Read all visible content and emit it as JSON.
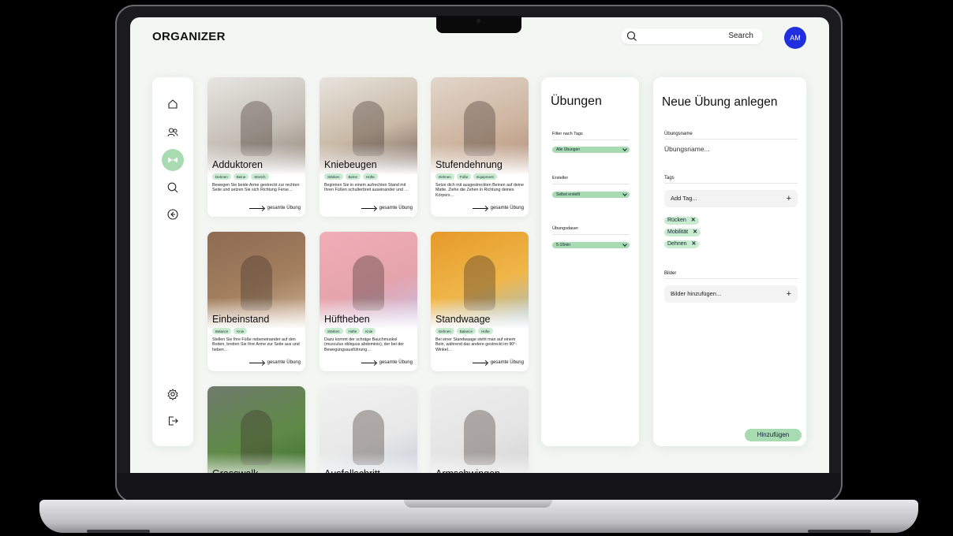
{
  "app": {
    "title": "ORGANIZER"
  },
  "search": {
    "label": "Search"
  },
  "avatar": {
    "initials": "AM"
  },
  "sidebar": {
    "items": [
      {
        "name": "home-icon"
      },
      {
        "name": "users-icon"
      },
      {
        "name": "exercise-icon",
        "active": true
      },
      {
        "name": "search-icon"
      },
      {
        "name": "back-icon"
      }
    ],
    "bottom": [
      {
        "name": "settings-icon"
      },
      {
        "name": "logout-icon"
      }
    ]
  },
  "cards": [
    {
      "title": "Adduktoren",
      "tags": [
        "Dehnen",
        "Beine",
        "Stretch"
      ],
      "desc": "Bewegen Sie beide Arme gestreckt zur rechten Seite und setzen Sie sich Richtung Ferse…",
      "link": "gesamte Übung",
      "colors": [
        "#e8e6e2",
        "#c4beb5",
        "#8b7d72"
      ]
    },
    {
      "title": "Kniebeugen",
      "tags": [
        "Stärken",
        "Beine",
        "Hüfte"
      ],
      "desc": "Beginnen Sie in einem aufrechten Stand mit Ihren Füßen schulterbreit auseinander und …",
      "link": "gesamte Übung",
      "colors": [
        "#e7e4dd",
        "#c9b9a6",
        "#6e5b52"
      ]
    },
    {
      "title": "Stufendehnung",
      "tags": [
        "Dehnen",
        "Füße",
        "Equipment"
      ],
      "desc": "Setze dich mit ausgestreckten Beinen auf deine Matte. Ziehe die Zehen in Richtung deines Körpers…",
      "link": "gesamte Übung",
      "colors": [
        "#e2d6cb",
        "#cdb5a0",
        "#b28d75"
      ]
    },
    {
      "title": "Einbeinstand",
      "tags": [
        "Balance",
        "Knie"
      ],
      "desc": "Stellen Sie Ihre Füße nebeneinander auf den Boden, breiten Sie Ihre Arme zur Seite aus und heben…",
      "link": "gesamte Übung",
      "colors": [
        "#8d6a52",
        "#a4805f",
        "#d0b79c"
      ]
    },
    {
      "title": "Hüftheben",
      "tags": [
        "Stärken",
        "Hüfte",
        "Knie"
      ],
      "desc": "Dazu kommt der schräge Bauchmuskel (musculus obliquus abdominis), der bei der Bewegungsausführung…",
      "link": "gesamte Übung",
      "colors": [
        "#f2aeb8",
        "#e5a3ac",
        "#c8c0e6"
      ]
    },
    {
      "title": "Standwaage",
      "tags": [
        "Dehnen",
        "Balance",
        "Hüfte"
      ],
      "desc": "Bei einer Standwaage steht man auf einem Bein, während das andere gestreckt im 90°-Winkel…",
      "link": "gesamte Übung",
      "colors": [
        "#e59a2a",
        "#f0b649",
        "#9fc3d8"
      ]
    },
    {
      "title": "Grasswalk",
      "tags": [],
      "desc": "",
      "link": "",
      "colors": [
        "#6f7b6d",
        "#5e8a46",
        "#3b6e2c"
      ]
    },
    {
      "title": "Ausfallschritt",
      "tags": [],
      "desc": "",
      "link": "",
      "colors": [
        "#f2f2f2",
        "#e8e8e8",
        "#bfc9d6"
      ]
    },
    {
      "title": "Armschwingen",
      "tags": [],
      "desc": "",
      "link": "",
      "colors": [
        "#eeeeee",
        "#e4e4e4",
        "#cfcfcf"
      ]
    }
  ],
  "filters": {
    "title": "Übungen",
    "groups": [
      {
        "label": "Filter nach Tags",
        "value": "Alle Übungen"
      },
      {
        "label": "Ersteller",
        "value": "Selbst erstellt"
      },
      {
        "label": "Übungsdauer",
        "value": "5-10min"
      }
    ]
  },
  "new_exercise": {
    "title": "Neue Übung anlegen",
    "name_label": "Übungsname",
    "name_placeholder": "Übungsname...",
    "tags_label": "Tags",
    "add_tag": "Add Tag...",
    "tags": [
      "Rücken",
      "Mobilität",
      "Dehnen"
    ],
    "images_label": "Bilder",
    "add_images": "Bilder hinzufügen...",
    "submit": "Hinzufügen"
  }
}
